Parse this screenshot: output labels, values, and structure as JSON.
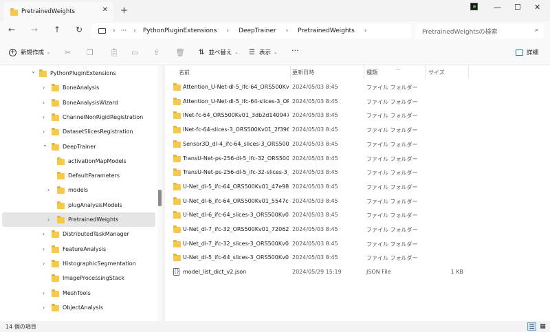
{
  "tab": {
    "title": "PretrainedWeights",
    "close": "✕",
    "new": "+"
  },
  "window": {
    "minimize": "—",
    "maximize": "☐",
    "close": "✕"
  },
  "nav": {
    "back": "←",
    "forward": "→",
    "up": "↑",
    "refresh": "↻"
  },
  "address": {
    "more": "···",
    "crumbs": [
      "PythonPluginExtensions",
      "DeepTrainer",
      "PretrainedWeights"
    ]
  },
  "search": {
    "placeholder": "PretrainedWeightsの検索"
  },
  "toolbar": {
    "new_label": "新規作成",
    "sort_label": "並べ替え",
    "view_label": "表示",
    "more": "···",
    "details_label": "詳細"
  },
  "sidebar": {
    "items": [
      {
        "label": "PythonPluginExtensions",
        "expanded": true,
        "level": 0
      },
      {
        "label": "BoneAnalysis",
        "expanded": false,
        "level": 1
      },
      {
        "label": "BoneAnalysisWizard",
        "expanded": false,
        "level": 1
      },
      {
        "label": "ChannelNonRigidRegistration",
        "expanded": false,
        "level": 1
      },
      {
        "label": "DatasetSlicesRegistration",
        "expanded": false,
        "level": 1
      },
      {
        "label": "DeepTrainer",
        "expanded": true,
        "level": 1
      },
      {
        "label": "activationMapModels",
        "level": 2
      },
      {
        "label": "DefaultParameters",
        "level": 2
      },
      {
        "label": "models",
        "expanded": false,
        "level": 2
      },
      {
        "label": "plugAnalysisModels",
        "level": 2
      },
      {
        "label": "PretrainedWeights",
        "expanded": false,
        "level": 2,
        "selected": true
      },
      {
        "label": "DistributedTaskManager",
        "expanded": false,
        "level": 1
      },
      {
        "label": "FeatureAnalysis",
        "expanded": false,
        "level": 1
      },
      {
        "label": "HistographicSegmentation",
        "expanded": false,
        "level": 1
      },
      {
        "label": "ImageProcessingStack",
        "level": 1
      },
      {
        "label": "MeshTools",
        "expanded": false,
        "level": 1
      },
      {
        "label": "ObjectAnalysis",
        "expanded": false,
        "level": 1
      }
    ]
  },
  "columns": {
    "name": "名前",
    "date": "更新日時",
    "type": "種類",
    "size": "サイズ"
  },
  "files": [
    {
      "name": "Attention_U-Net-dl-5_ifc-64_ORS500Kv0...",
      "date": "2024/05/03 8:45",
      "type": "ファイル フォルダー",
      "size": "",
      "kind": "folder"
    },
    {
      "name": "Attention_U-Net-dl-5_ifc-64-slices-3_OR...",
      "date": "2024/05/03 8:45",
      "type": "ファイル フォルダー",
      "size": "",
      "kind": "folder"
    },
    {
      "name": "INet-fc-64_ORS500Kv01_3db2d1409478...",
      "date": "2024/05/03 8:45",
      "type": "ファイル フォルダー",
      "size": "",
      "kind": "folder"
    },
    {
      "name": "INet-fc-64-slices-3_ORS500Kv01_2f396a...",
      "date": "2024/05/03 8:45",
      "type": "ファイル フォルダー",
      "size": "",
      "kind": "folder"
    },
    {
      "name": "Sensor3D_dl-4_ifc-64_slices-3_ORS500Kv...",
      "date": "2024/05/03 8:45",
      "type": "ファイル フォルダー",
      "size": "",
      "kind": "folder"
    },
    {
      "name": "TransU-Net-ps-256-dl-5_ifc-32_ORS500K...",
      "date": "2024/05/03 8:45",
      "type": "ファイル フォルダー",
      "size": "",
      "kind": "folder"
    },
    {
      "name": "TransU-Net-ps-256-dl-5_ifc-32-slices-3_...",
      "date": "2024/05/03 8:45",
      "type": "ファイル フォルダー",
      "size": "",
      "kind": "folder"
    },
    {
      "name": "U-Net_dl-5_ifc-64_ORS500Kv01_47e986a...",
      "date": "2024/05/03 8:45",
      "type": "ファイル フォルダー",
      "size": "",
      "kind": "folder"
    },
    {
      "name": "U-Net_dl-6_ifc-64_ORS500Kv01_5547cdf...",
      "date": "2024/05/03 8:45",
      "type": "ファイル フォルダー",
      "size": "",
      "kind": "folder"
    },
    {
      "name": "U-Net_dl-6_ifc-64_slices-3_ORS500Kv01_...",
      "date": "2024/05/03 8:45",
      "type": "ファイル フォルダー",
      "size": "",
      "kind": "folder"
    },
    {
      "name": "U-Net_dl-7_ifc-32_ORS500Kv01_720629...",
      "date": "2024/05/03 8:45",
      "type": "ファイル フォルダー",
      "size": "",
      "kind": "folder"
    },
    {
      "name": "U-Net_dl-7_ifc-32_slices-3_ORS500Kv01_...",
      "date": "2024/05/03 8:45",
      "type": "ファイル フォルダー",
      "size": "",
      "kind": "folder"
    },
    {
      "name": "U-Net_dl-5_ifc-64_slices-3_ORS500Kv01_...",
      "date": "2024/05/03 8:45",
      "type": "ファイル フォルダー",
      "size": "",
      "kind": "folder"
    },
    {
      "name": "model_list_dict_v2.json",
      "date": "2024/05/29 15:19",
      "type": "JSON File",
      "size": "1 KB",
      "kind": "json"
    }
  ],
  "status": {
    "count": "14 個の項目"
  }
}
